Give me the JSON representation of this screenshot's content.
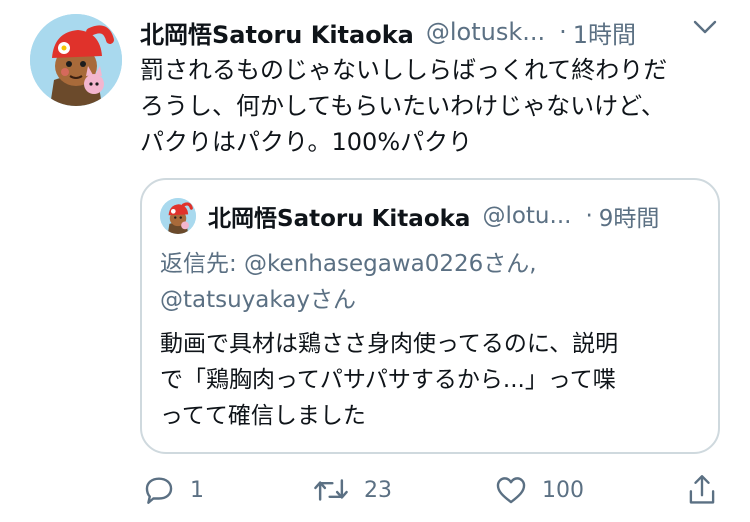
{
  "tweet": {
    "display_name": "北岡悟Satoru Kitaoka",
    "handle": "@lotusk...",
    "separator": "·",
    "time": "1時間",
    "text_lines": [
      "罰されるものじゃないししらばっくれて終わりだ",
      "ろうし、何かしてもらいたいわけじゃないけど、",
      "パクりはパクり。100%パクり"
    ]
  },
  "quoted_tweet": {
    "display_name": "北岡悟Satoru Kitaoka",
    "handle": "@lotu...",
    "separator": "·",
    "time": "9時間",
    "reply_lines": [
      "返信先: @kenhasegawa0226さん,",
      "@tatsuyakayさん"
    ],
    "text_lines": [
      "動画で具材は鶏ささ身肉使ってるのに、説明",
      "で「鶏胸肉ってパサパサするから...」って喋",
      "ってて確信しました"
    ]
  },
  "actions": {
    "reply": {
      "icon": "reply-icon",
      "count": "1"
    },
    "retweet": {
      "icon": "retweet-icon",
      "count": "23"
    },
    "like": {
      "icon": "heart-icon",
      "count": "100"
    },
    "share": {
      "icon": "share-icon"
    }
  },
  "colors": {
    "text": "#0f1419",
    "secondary": "#5b7083",
    "border": "#cfd9de",
    "avatar_bg": "#a9d9ee",
    "hat_red": "#e0322b"
  }
}
